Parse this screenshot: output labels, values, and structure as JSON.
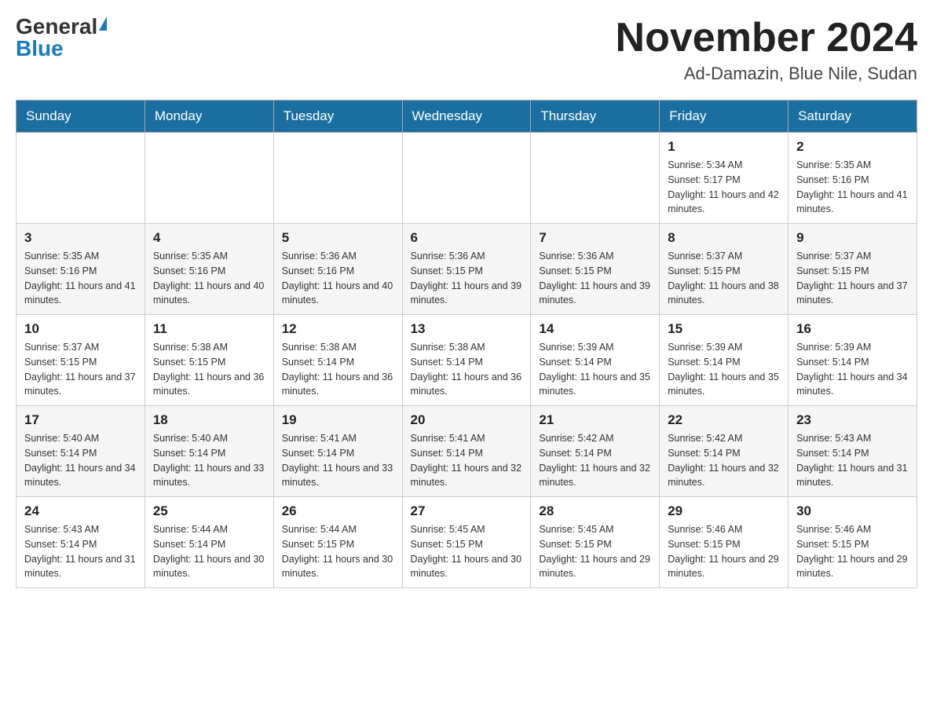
{
  "header": {
    "logo_general": "General",
    "logo_blue": "Blue",
    "month_title": "November 2024",
    "location": "Ad-Damazin, Blue Nile, Sudan"
  },
  "days_of_week": [
    "Sunday",
    "Monday",
    "Tuesday",
    "Wednesday",
    "Thursday",
    "Friday",
    "Saturday"
  ],
  "weeks": [
    [
      {
        "day": "",
        "info": ""
      },
      {
        "day": "",
        "info": ""
      },
      {
        "day": "",
        "info": ""
      },
      {
        "day": "",
        "info": ""
      },
      {
        "day": "",
        "info": ""
      },
      {
        "day": "1",
        "info": "Sunrise: 5:34 AM\nSunset: 5:17 PM\nDaylight: 11 hours and 42 minutes."
      },
      {
        "day": "2",
        "info": "Sunrise: 5:35 AM\nSunset: 5:16 PM\nDaylight: 11 hours and 41 minutes."
      }
    ],
    [
      {
        "day": "3",
        "info": "Sunrise: 5:35 AM\nSunset: 5:16 PM\nDaylight: 11 hours and 41 minutes."
      },
      {
        "day": "4",
        "info": "Sunrise: 5:35 AM\nSunset: 5:16 PM\nDaylight: 11 hours and 40 minutes."
      },
      {
        "day": "5",
        "info": "Sunrise: 5:36 AM\nSunset: 5:16 PM\nDaylight: 11 hours and 40 minutes."
      },
      {
        "day": "6",
        "info": "Sunrise: 5:36 AM\nSunset: 5:15 PM\nDaylight: 11 hours and 39 minutes."
      },
      {
        "day": "7",
        "info": "Sunrise: 5:36 AM\nSunset: 5:15 PM\nDaylight: 11 hours and 39 minutes."
      },
      {
        "day": "8",
        "info": "Sunrise: 5:37 AM\nSunset: 5:15 PM\nDaylight: 11 hours and 38 minutes."
      },
      {
        "day": "9",
        "info": "Sunrise: 5:37 AM\nSunset: 5:15 PM\nDaylight: 11 hours and 37 minutes."
      }
    ],
    [
      {
        "day": "10",
        "info": "Sunrise: 5:37 AM\nSunset: 5:15 PM\nDaylight: 11 hours and 37 minutes."
      },
      {
        "day": "11",
        "info": "Sunrise: 5:38 AM\nSunset: 5:15 PM\nDaylight: 11 hours and 36 minutes."
      },
      {
        "day": "12",
        "info": "Sunrise: 5:38 AM\nSunset: 5:14 PM\nDaylight: 11 hours and 36 minutes."
      },
      {
        "day": "13",
        "info": "Sunrise: 5:38 AM\nSunset: 5:14 PM\nDaylight: 11 hours and 36 minutes."
      },
      {
        "day": "14",
        "info": "Sunrise: 5:39 AM\nSunset: 5:14 PM\nDaylight: 11 hours and 35 minutes."
      },
      {
        "day": "15",
        "info": "Sunrise: 5:39 AM\nSunset: 5:14 PM\nDaylight: 11 hours and 35 minutes."
      },
      {
        "day": "16",
        "info": "Sunrise: 5:39 AM\nSunset: 5:14 PM\nDaylight: 11 hours and 34 minutes."
      }
    ],
    [
      {
        "day": "17",
        "info": "Sunrise: 5:40 AM\nSunset: 5:14 PM\nDaylight: 11 hours and 34 minutes."
      },
      {
        "day": "18",
        "info": "Sunrise: 5:40 AM\nSunset: 5:14 PM\nDaylight: 11 hours and 33 minutes."
      },
      {
        "day": "19",
        "info": "Sunrise: 5:41 AM\nSunset: 5:14 PM\nDaylight: 11 hours and 33 minutes."
      },
      {
        "day": "20",
        "info": "Sunrise: 5:41 AM\nSunset: 5:14 PM\nDaylight: 11 hours and 32 minutes."
      },
      {
        "day": "21",
        "info": "Sunrise: 5:42 AM\nSunset: 5:14 PM\nDaylight: 11 hours and 32 minutes."
      },
      {
        "day": "22",
        "info": "Sunrise: 5:42 AM\nSunset: 5:14 PM\nDaylight: 11 hours and 32 minutes."
      },
      {
        "day": "23",
        "info": "Sunrise: 5:43 AM\nSunset: 5:14 PM\nDaylight: 11 hours and 31 minutes."
      }
    ],
    [
      {
        "day": "24",
        "info": "Sunrise: 5:43 AM\nSunset: 5:14 PM\nDaylight: 11 hours and 31 minutes."
      },
      {
        "day": "25",
        "info": "Sunrise: 5:44 AM\nSunset: 5:14 PM\nDaylight: 11 hours and 30 minutes."
      },
      {
        "day": "26",
        "info": "Sunrise: 5:44 AM\nSunset: 5:15 PM\nDaylight: 11 hours and 30 minutes."
      },
      {
        "day": "27",
        "info": "Sunrise: 5:45 AM\nSunset: 5:15 PM\nDaylight: 11 hours and 30 minutes."
      },
      {
        "day": "28",
        "info": "Sunrise: 5:45 AM\nSunset: 5:15 PM\nDaylight: 11 hours and 29 minutes."
      },
      {
        "day": "29",
        "info": "Sunrise: 5:46 AM\nSunset: 5:15 PM\nDaylight: 11 hours and 29 minutes."
      },
      {
        "day": "30",
        "info": "Sunrise: 5:46 AM\nSunset: 5:15 PM\nDaylight: 11 hours and 29 minutes."
      }
    ]
  ]
}
